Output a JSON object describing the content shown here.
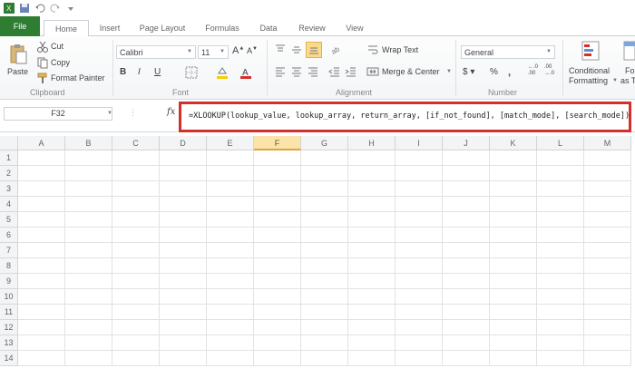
{
  "tabs": [
    "File",
    "Home",
    "Insert",
    "Page Layout",
    "Formulas",
    "Data",
    "Review",
    "View"
  ],
  "ribbon": {
    "clipboard": {
      "paste": "Paste",
      "cut": "Cut",
      "copy": "Copy",
      "format_painter": "Format Painter",
      "label": "Clipboard"
    },
    "font": {
      "name": "Calibri",
      "size": "11",
      "label": "Font"
    },
    "alignment": {
      "wrap_text": "Wrap Text",
      "merge_center": "Merge & Center",
      "label": "Alignment"
    },
    "number": {
      "format": "General",
      "label": "Number"
    },
    "styles": {
      "conditional": "Conditional",
      "formatting": "Formatting",
      "fo": "Fo",
      "as_t": "as T"
    }
  },
  "formula_bar": {
    "name_box": "F32",
    "fx": "fx",
    "formula": "=XLOOKUP(lookup_value, lookup_array, return_array, [if_not_found], [match_mode], [search_mode])"
  },
  "columns": [
    "A",
    "B",
    "C",
    "D",
    "E",
    "F",
    "G",
    "H",
    "I",
    "J",
    "K",
    "L",
    "M"
  ],
  "selected_column": "F",
  "rows": [
    "1",
    "2",
    "3",
    "4",
    "5",
    "6",
    "7",
    "8",
    "9",
    "10",
    "11",
    "12",
    "13",
    "14"
  ],
  "colors": {
    "file_tab": "#2e7d32",
    "highlight_border": "#d32f2f",
    "selected_header": "#fbe3a9"
  }
}
